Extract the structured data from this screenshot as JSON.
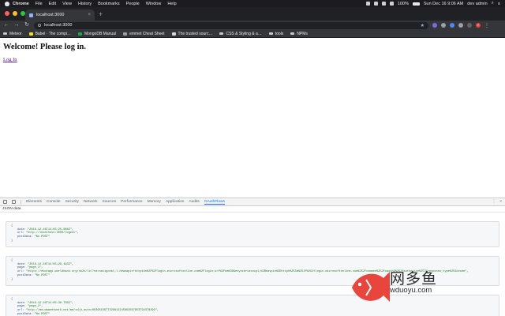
{
  "menubar": {
    "items": [
      "Chrome",
      "File",
      "Edit",
      "View",
      "History",
      "Bookmarks",
      "People",
      "Window",
      "Help"
    ],
    "battery": "100%",
    "datetime": "Sun Dec 16  9:06 AM",
    "user": "dev admin"
  },
  "tab": {
    "title": "localhost:3000"
  },
  "omnibox": {
    "url": "localhost:3000"
  },
  "bookmarks": [
    "Meteor",
    "Babel · The compi…",
    "MongoDB Manual",
    "emmet Cheat Sheet",
    "The trusted sourc…",
    "CSS & Styling & a…",
    "tools",
    "NPMs"
  ],
  "page": {
    "heading": "Welcome! Please log in.",
    "login_link": "Log In"
  },
  "devtools": {
    "tabs": [
      "Elements",
      "Console",
      "Security",
      "Network",
      "Sources",
      "Performance",
      "Memory",
      "Application",
      "Audits",
      "OAuthFlows"
    ],
    "active_tab": "OAuthFlows",
    "panel_label": "JSON data"
  },
  "records": [
    {
      "date": "\"2018-12-16T14:05:25.088Z\"",
      "url": "\"http://localhost:3000/logout\"",
      "postData": "\"No POST\""
    },
    {
      "date": "\"2018-12-16T14:05:29.193Z\"",
      "page": "\"page_1\"",
      "url": "\"https://nbotapp.worldbank.org/nb2s/lo/?se=navigonal;l.newnapix+kttpk4s%2F%2Flogin.microsoftonline.com%2Flogin;srf%2Fkm%3D&esyncertasscp1;%2Beavpin%3Dhttpk%253a%252f%252flogin.microsoftonline.com%252fcommon%252foauth2%252fauthorize%253fresponse_type%253dcode\"",
      "postData": "\"No POST\""
    },
    {
      "date": "\"2018-12-16T14:05:30.736Z\"",
      "page": "\"page_2\"",
      "url": "\"http://mm.wwwnetwork.net/mm/sd/d_auto=6039515677329812245863567853794378299\"",
      "postData": "\"No POST\""
    }
  ],
  "watermark": {
    "text": "网多鱼",
    "url": "wduoyu.com"
  },
  "colors": {
    "menubar": "#1c1c1e",
    "chrome_dark": "#35363a",
    "devtools_active": "#1a73e8",
    "watermark_fish": "#e8453c"
  }
}
